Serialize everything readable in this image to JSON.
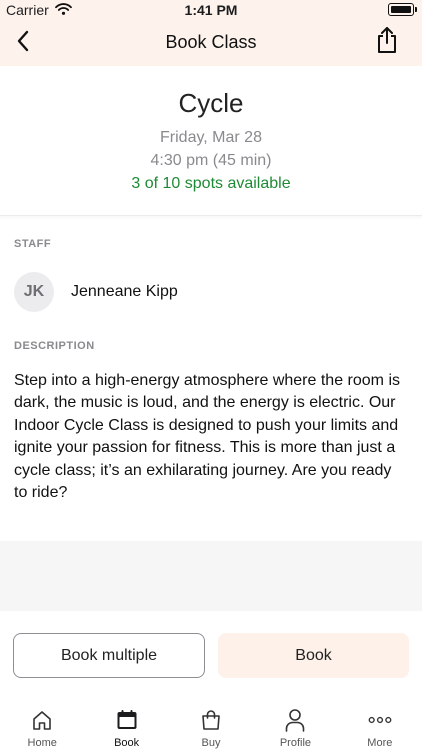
{
  "status_bar": {
    "carrier": "Carrier",
    "time": "1:41 PM"
  },
  "nav": {
    "title": "Book Class",
    "back_icon": "chevron-left-icon",
    "share_icon": "share-icon"
  },
  "class_info": {
    "name": "Cycle",
    "date": "Friday, Mar 28",
    "time": "4:30 pm (45 min)",
    "spots": "3 of 10 spots available",
    "spots_color": "#1f8a35"
  },
  "staff": {
    "label": "STAFF",
    "initials": "JK",
    "name": "Jenneane Kipp"
  },
  "description": {
    "label": "DESCRIPTION",
    "text": "Step into a high-energy atmosphere where the room is dark, the music is loud, and the energy is electric. Our Indoor Cycle Class is designed to push your limits and ignite your passion for fitness. This is more than just a cycle class; it’s an exhilarating journey. Are you ready to ride?"
  },
  "actions": {
    "book_multiple": "Book multiple",
    "book": "Book"
  },
  "tabs": [
    {
      "label": "Home",
      "icon": "home-icon"
    },
    {
      "label": "Book",
      "icon": "calendar-icon",
      "active": true
    },
    {
      "label": "Buy",
      "icon": "shopping-bag-icon"
    },
    {
      "label": "Profile",
      "icon": "person-icon"
    },
    {
      "label": "More",
      "icon": "more-icon"
    }
  ],
  "colors": {
    "accent_bg": "#fdf3ec",
    "book_button_bg": "#fdf1e9"
  }
}
